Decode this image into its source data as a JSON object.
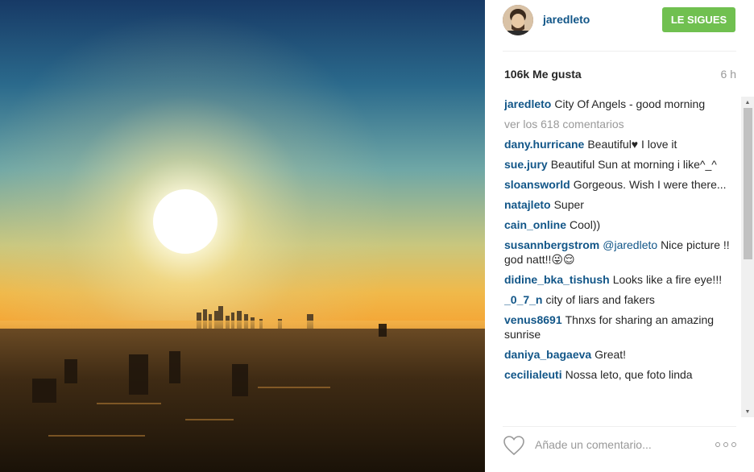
{
  "post": {
    "image_alt": "",
    "likes": "106k Me gusta",
    "time": "6 h"
  },
  "header": {
    "username": "jaredleto",
    "follow_label": "LE SIGUES",
    "follow_color": "#70c050",
    "avatar_icon": "user-avatar"
  },
  "caption": {
    "user": "jaredleto",
    "text": "City Of Angels - good morning"
  },
  "view_all_comments": "ver los 618 comentarios",
  "comments": [
    {
      "user": "dany.hurricane",
      "text": "Beautiful♥ I love it"
    },
    {
      "user": "sue.jury",
      "text": "Beautiful Sun at morning i like^_^"
    },
    {
      "user": "sloansworld",
      "text": "Gorgeous. Wish I were there..."
    },
    {
      "user": "natajleto",
      "text": "Super"
    },
    {
      "user": "cain_online",
      "text": "Cool))"
    },
    {
      "user": "susannbergstrom",
      "mention": "@jaredleto",
      "text": "Nice picture !! god natt!!😜😌"
    },
    {
      "user": "didine_bka_tishush",
      "text": "Looks like a fire eye!!!"
    },
    {
      "user": "_0_7_n",
      "text": "city of liars and fakers"
    },
    {
      "user": "venus8691",
      "text": "Thnxs for sharing an amazing sunrise"
    },
    {
      "user": "daniya_bagaeva",
      "text": "Great!"
    },
    {
      "user": "cecilialeuti",
      "text": "Nossa leto, que foto linda"
    }
  ],
  "comment_bar": {
    "placeholder": "Añade un comentario...",
    "like_icon": "heart-icon",
    "more_icon": "more-options-icon"
  },
  "colors": {
    "link": "#125688",
    "muted": "#999999",
    "text": "#262626"
  }
}
